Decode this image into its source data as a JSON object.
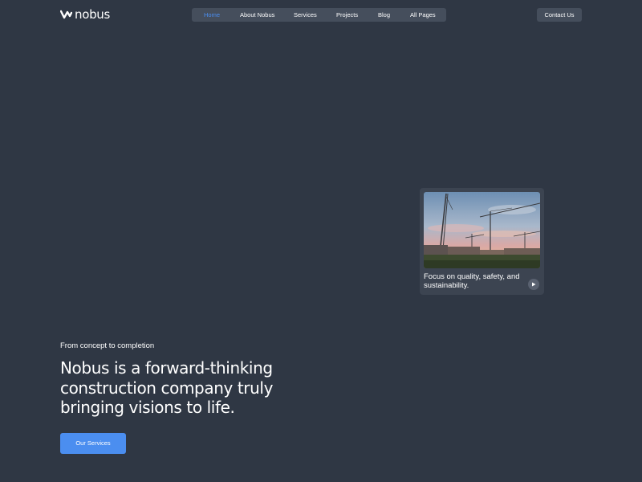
{
  "header": {
    "logo_text": "nobus",
    "nav": [
      {
        "label": "Home",
        "active": true
      },
      {
        "label": "About Nobus",
        "active": false
      },
      {
        "label": "Services",
        "active": false
      },
      {
        "label": "Projects",
        "active": false
      },
      {
        "label": "Blog",
        "active": false
      },
      {
        "label": "All Pages",
        "active": false
      }
    ],
    "contact_label": "Contact Us"
  },
  "card": {
    "image_icon": "construction-cranes-photo",
    "caption": "Focus on quality, safety, and sustainability.",
    "play_icon": "play-icon"
  },
  "hero": {
    "eyebrow": "From concept to completion",
    "headline": "Nobus is a forward-thinking construction company truly bringing visions to life.",
    "cta_label": "Our Services"
  },
  "colors": {
    "background": "#2f3744",
    "accent": "#4b8ef0",
    "nav_background": "#454e5c",
    "card_background": "#3c4451"
  }
}
